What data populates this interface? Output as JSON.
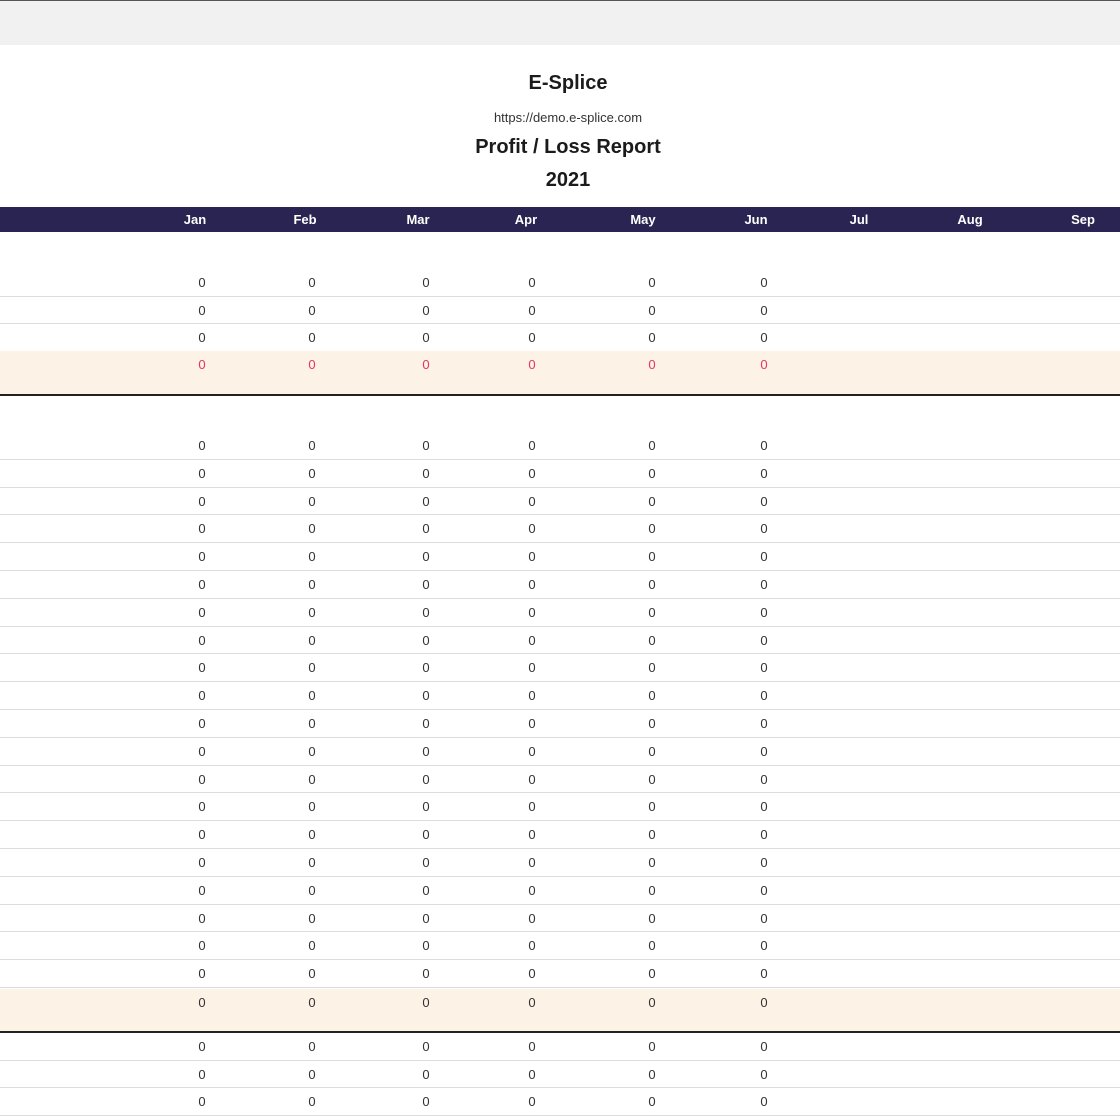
{
  "report": {
    "company": "E-Splice",
    "url": "https://demo.e-splice.com",
    "title": "Profit / Loss Report",
    "year": "2021"
  },
  "months": [
    "Jan",
    "Feb",
    "Mar",
    "Apr",
    "May",
    "Jun",
    "Jul",
    "Aug",
    "Sep"
  ],
  "sections": [
    {
      "rows": [
        [
          "0",
          "0",
          "0",
          "0",
          "0",
          "0"
        ],
        [
          "0",
          "0",
          "0",
          "0",
          "0",
          "0"
        ],
        [
          "0",
          "0",
          "0",
          "0",
          "0",
          "0"
        ]
      ],
      "total": [
        "0",
        "0",
        "0",
        "0",
        "0",
        "0"
      ],
      "total_color": "#e8345a"
    },
    {
      "rows": [
        [
          "0",
          "0",
          "0",
          "0",
          "0",
          "0"
        ],
        [
          "0",
          "0",
          "0",
          "0",
          "0",
          "0"
        ],
        [
          "0",
          "0",
          "0",
          "0",
          "0",
          "0"
        ],
        [
          "0",
          "0",
          "0",
          "0",
          "0",
          "0"
        ],
        [
          "0",
          "0",
          "0",
          "0",
          "0",
          "0"
        ],
        [
          "0",
          "0",
          "0",
          "0",
          "0",
          "0"
        ],
        [
          "0",
          "0",
          "0",
          "0",
          "0",
          "0"
        ],
        [
          "0",
          "0",
          "0",
          "0",
          "0",
          "0"
        ],
        [
          "0",
          "0",
          "0",
          "0",
          "0",
          "0"
        ],
        [
          "0",
          "0",
          "0",
          "0",
          "0",
          "0"
        ],
        [
          "0",
          "0",
          "0",
          "0",
          "0",
          "0"
        ],
        [
          "0",
          "0",
          "0",
          "0",
          "0",
          "0"
        ],
        [
          "0",
          "0",
          "0",
          "0",
          "0",
          "0"
        ],
        [
          "0",
          "0",
          "0",
          "0",
          "0",
          "0"
        ],
        [
          "0",
          "0",
          "0",
          "0",
          "0",
          "0"
        ],
        [
          "0",
          "0",
          "0",
          "0",
          "0",
          "0"
        ],
        [
          "0",
          "0",
          "0",
          "0",
          "0",
          "0"
        ],
        [
          "0",
          "0",
          "0",
          "0",
          "0",
          "0"
        ],
        [
          "0",
          "0",
          "0",
          "0",
          "0",
          "0"
        ],
        [
          "0",
          "0",
          "0",
          "0",
          "0",
          "0"
        ]
      ],
      "total": [
        "0",
        "0",
        "0",
        "0",
        "0",
        "0"
      ]
    },
    {
      "rows": [
        [
          "0",
          "0",
          "0",
          "0",
          "0",
          "0"
        ],
        [
          "0",
          "0",
          "0",
          "0",
          "0",
          "0"
        ],
        [
          "0",
          "0",
          "0",
          "0",
          "0",
          "0"
        ]
      ]
    }
  ],
  "colors": {
    "header_bar": "#2a2452",
    "total_row_bg": "#fdf2e6",
    "negative_text": "#e8345a"
  }
}
